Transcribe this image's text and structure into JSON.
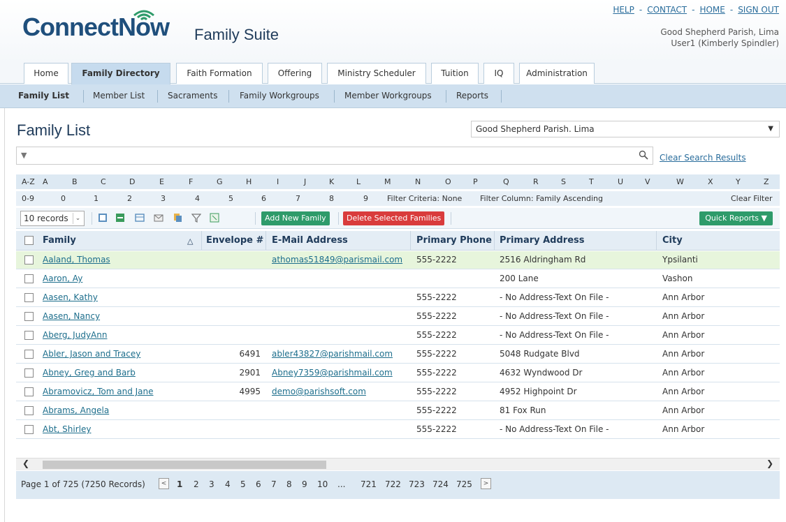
{
  "header": {
    "logo_part1": "Connect",
    "logo_part2": "Now",
    "suite": "Family Suite",
    "links": [
      "HELP",
      "CONTACT",
      "HOME",
      "SIGN OUT"
    ],
    "parish_line": "Good Shepherd Parish, Lima",
    "user_line": "User1 (Kimberly Spindler)"
  },
  "main_tabs": [
    "Home",
    "Family Directory",
    "Faith Formation",
    "Offering",
    "Ministry Scheduler",
    "Tuition",
    "IQ",
    "Administration"
  ],
  "active_main_tab": "Family Directory",
  "sub_tabs": [
    "Family List",
    "Member List",
    "Sacraments",
    "Family Workgroups",
    "Member Workgroups",
    "Reports"
  ],
  "active_sub_tab": "Family List",
  "page_title": "Family List",
  "parish_select": "Good Shepherd Parish. Lima",
  "search": {
    "value": "",
    "clear_label": "Clear Search Results"
  },
  "alpha_row1": [
    "A-Z",
    "A",
    "B",
    "C",
    "D",
    "E",
    "F",
    "G",
    "H",
    "I",
    "J",
    "K",
    "L",
    "M",
    "N",
    "O",
    "P",
    "Q",
    "R",
    "S",
    "T",
    "U",
    "V",
    "W",
    "X",
    "Y",
    "Z"
  ],
  "alpha_row2": [
    "0-9",
    "0",
    "1",
    "2",
    "3",
    "4",
    "5",
    "6",
    "7",
    "8",
    "9"
  ],
  "filter": {
    "criteria_label": "Filter Criteria:",
    "criteria_value": "None",
    "column_label": "Filter Column:",
    "column_value": "Family Ascending",
    "clear_label": "Clear Filter"
  },
  "toolbar": {
    "records": "10 records",
    "add_label": "Add New Family",
    "delete_label": "Delete Selected Families",
    "quick_label": "Quick Reports ▼"
  },
  "columns": [
    "Family",
    "Envelope #",
    "E-Mail Address",
    "Primary Phone",
    "Primary Address",
    "City"
  ],
  "rows": [
    {
      "family": "Aaland, Thomas",
      "envelope": "",
      "email": "athomas51849@parismail.com",
      "phone": "555-2222",
      "address": "2516 Aldringham Rd",
      "city": "Ypsilanti"
    },
    {
      "family": "Aaron, Ay",
      "envelope": "",
      "email": "",
      "phone": "",
      "address": "200 Lane",
      "city": "Vashon"
    },
    {
      "family": "Aasen, Kathy",
      "envelope": "",
      "email": "",
      "phone": "555-2222",
      "address": "- No Address-Text On File -",
      "city": "Ann Arbor"
    },
    {
      "family": "Aasen, Nancy",
      "envelope": "",
      "email": "",
      "phone": "555-2222",
      "address": "- No Address-Text On File -",
      "city": "Ann Arbor"
    },
    {
      "family": "Aberg, JudyAnn",
      "envelope": "",
      "email": "",
      "phone": "555-2222",
      "address": "- No Address-Text On File -",
      "city": "Ann Arbor"
    },
    {
      "family": "Abler, Jason and Tracey",
      "envelope": "6491",
      "email": "abler43827@parishmail.com",
      "phone": "555-2222",
      "address": "5048 Rudgate Blvd",
      "city": "Ann Arbor"
    },
    {
      "family": "Abney, Greg and Barb",
      "envelope": "2901",
      "email": "Abney7359@parishmail.com",
      "phone": "555-2222",
      "address": "4632 Wyndwood Dr",
      "city": "Ann Arbor"
    },
    {
      "family": "Abramovicz, Tom and Jane",
      "envelope": "4995",
      "email": "demo@parishsoft.com",
      "phone": "555-2222",
      "address": "4952 Highpoint Dr",
      "city": "Ann Arbor"
    },
    {
      "family": "Abrams, Angela",
      "envelope": "",
      "email": "",
      "phone": "555-2222",
      "address": "81 Fox Run",
      "city": "Ann Arbor"
    },
    {
      "family": "Abt, Shirley",
      "envelope": "",
      "email": "",
      "phone": "555-2222",
      "address": "- No Address-Text On File -",
      "city": "Ann Arbor"
    }
  ],
  "pager": {
    "summary": "Page 1 of 725 (7250 Records)",
    "pages": [
      "1",
      "2",
      "3",
      "4",
      "5",
      "6",
      "7",
      "8",
      "9",
      "10",
      "...",
      "721",
      "722",
      "723",
      "724",
      "725"
    ],
    "current": "1"
  },
  "colors": {
    "accent": "#2e9b6a",
    "danger": "#d93c3c",
    "link": "#1d6e8c",
    "header_blue": "#cfe0ef"
  }
}
